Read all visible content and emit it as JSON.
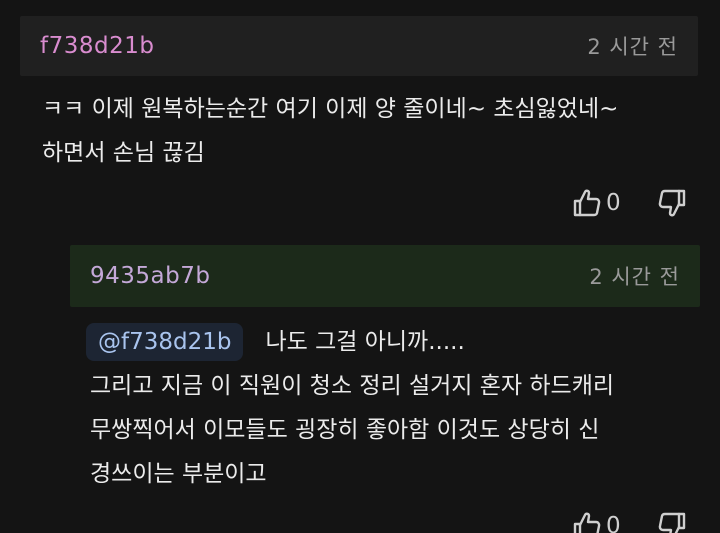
{
  "comment": {
    "author": "f738d21b",
    "time": "2 시간 전",
    "body_line1": "ㅋㅋ 이제 원복하는순간 여기 이제 양 줄이네~ 초심잃었네~",
    "body_line2": "하면서 손님 끊김",
    "like_count": "0"
  },
  "reply": {
    "author": "9435ab7b",
    "time": "2 시간 전",
    "mention": "@f738d21b",
    "line1_text": "나도 그걸 아니까.....",
    "line2": "그리고 지금 이 직원이 청소 정리 설거지 혼자 하드캐리",
    "line3": "무쌍찍어서 이모들도 굉장히 좋아함 이것도 상당히 신",
    "line4": "경쓰이는 부분이고",
    "like_count": "0"
  },
  "icons": {
    "like": "thumbs-up-icon",
    "dislike": "thumbs-down-icon"
  },
  "colors": {
    "background": "#141414",
    "author_pink": "#d98ccf",
    "mention_blue": "#a9c4ee",
    "reply_header_green": "#1c2a1a"
  }
}
